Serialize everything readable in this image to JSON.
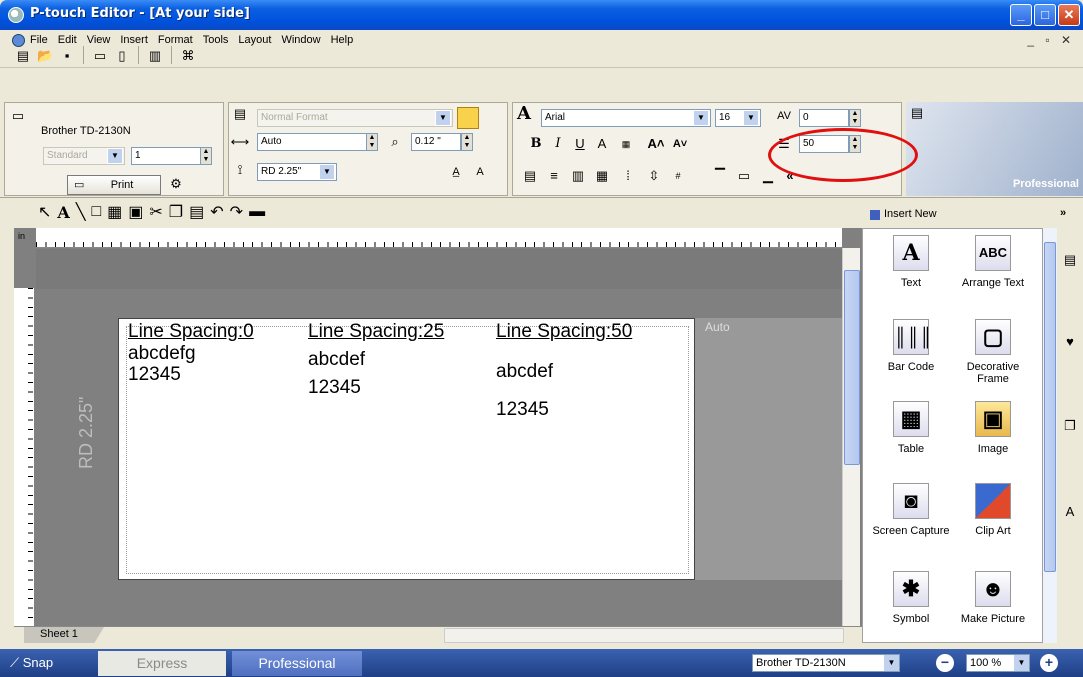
{
  "window": {
    "title": "P-touch Editor - [At your side]"
  },
  "menu": [
    "File",
    "Edit",
    "View",
    "Insert",
    "Format",
    "Tools",
    "Layout",
    "Window",
    "Help"
  ],
  "printer_panel": {
    "printer_name": "Brother TD-2130N",
    "mode": "Standard",
    "copies": "1",
    "print_label": "Print"
  },
  "format_panel": {
    "format": "Normal Format",
    "length": "Auto",
    "margin": "0.12 \"",
    "media": "RD 2.25\""
  },
  "text_panel": {
    "font": "Arial",
    "size": "16",
    "char_spacing": "0",
    "line_spacing": "50",
    "banner": "Professional"
  },
  "canvas": {
    "ruler_unit": "in",
    "media_label": "RD 2.25\"",
    "auto_label": "Auto",
    "columns": [
      {
        "heading": "Line Spacing:0",
        "line1": "abcdefg",
        "line2": "12345"
      },
      {
        "heading": "Line Spacing:25",
        "line1": "abcdef",
        "line2": "12345"
      },
      {
        "heading": "Line Spacing:50",
        "line1": "abcdef",
        "line2": "12345"
      }
    ],
    "sheet_tab": "Sheet 1"
  },
  "insert_panel": {
    "title": "Insert New",
    "items": [
      {
        "label": "Text",
        "icon": "text-icon"
      },
      {
        "label": "Arrange Text",
        "icon": "arrange-text-icon"
      },
      {
        "label": "Bar Code",
        "icon": "barcode-icon"
      },
      {
        "label": "Decorative Frame",
        "icon": "frame-icon"
      },
      {
        "label": "Table",
        "icon": "table-icon"
      },
      {
        "label": "Image",
        "icon": "image-icon"
      },
      {
        "label": "Screen Capture",
        "icon": "screen-capture-icon"
      },
      {
        "label": "Clip Art",
        "icon": "clipart-icon"
      },
      {
        "label": "Symbol",
        "icon": "symbol-icon"
      },
      {
        "label": "Make Picture",
        "icon": "make-picture-icon"
      }
    ]
  },
  "statusbar": {
    "snap": "Snap",
    "express": "Express",
    "professional": "Professional",
    "printer": "Brother TD-2130N",
    "zoom": "100 %"
  },
  "colors": {
    "titlebar": "#0052dd",
    "highlight": "#e01010",
    "statusbar": "#1f3f86"
  }
}
